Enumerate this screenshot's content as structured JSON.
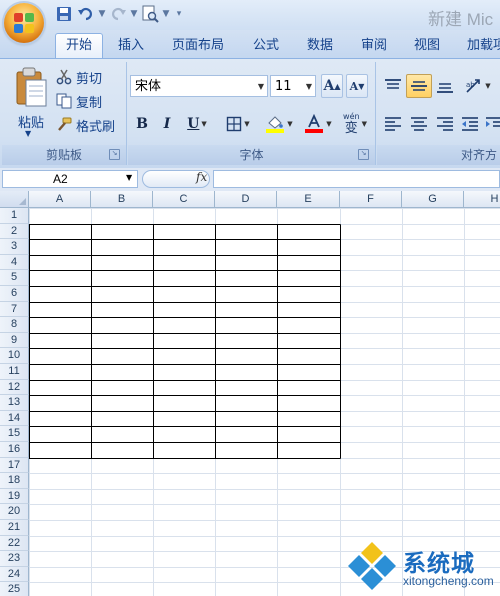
{
  "window": {
    "title": "新建 Mic"
  },
  "tabs": [
    "开始",
    "插入",
    "页面布局",
    "公式",
    "数据",
    "审阅",
    "视图",
    "加载项"
  ],
  "active_tab": 0,
  "clipboard": {
    "paste_label": "粘贴",
    "cut_label": "剪切",
    "copy_label": "复制",
    "format_painter_label": "格式刷",
    "group_label": "剪贴板"
  },
  "font": {
    "font_name": "宋体",
    "font_size": "11",
    "bold": "B",
    "italic": "I",
    "underline": "U",
    "grow_font": "A",
    "shrink_font": "A",
    "wen": "wén",
    "zi": "变",
    "group_label": "字体",
    "fill_color": "#ffff00",
    "font_color": "#ff0000"
  },
  "alignment": {
    "group_label": "对齐方"
  },
  "formula_bar": {
    "name_box": "A2",
    "fx": "fx"
  },
  "columns": [
    "A",
    "B",
    "C",
    "D",
    "E",
    "F",
    "G",
    "H"
  ],
  "rows": [
    "1",
    "2",
    "3",
    "4",
    "5",
    "6",
    "7",
    "8",
    "9",
    "10",
    "11",
    "12",
    "13",
    "14",
    "15",
    "16",
    "17",
    "18",
    "19",
    "20",
    "21",
    "22",
    "23",
    "24",
    "25"
  ],
  "watermark": {
    "name": "系统城",
    "url": "xitongcheng.com"
  },
  "accent": "#15428b"
}
